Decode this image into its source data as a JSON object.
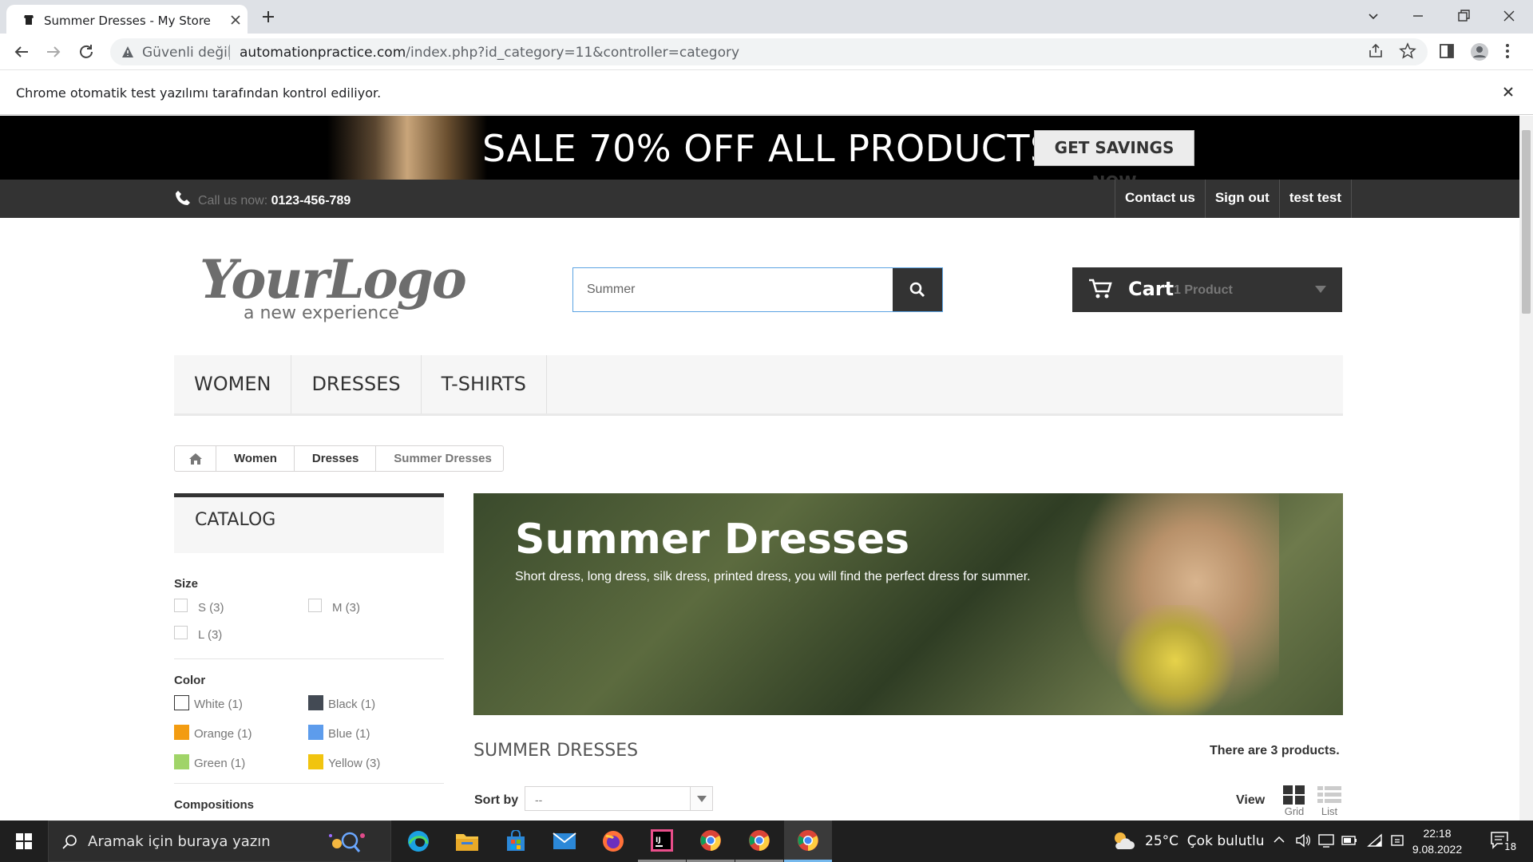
{
  "browser": {
    "tab_title": "Summer Dresses - My Store",
    "security_label": "Güvenli değil",
    "url_domain": "automationpractice.com",
    "url_path": "/index.php?id_category=11&controller=category",
    "infobar_text": "Chrome otomatik test yazılımı tarafından kontrol ediliyor."
  },
  "banner": {
    "text": "SALE 70% OFF ALL PRODUCTS",
    "button": "GET SAVINGS NOW"
  },
  "nav": {
    "call_label": "Call us now:",
    "phone": "0123-456-789",
    "links": [
      "Contact us",
      "Sign out",
      "test test"
    ]
  },
  "search": {
    "value": "Summer"
  },
  "cart": {
    "label": "Cart",
    "quantity": "1 Product"
  },
  "menu": [
    "WOMEN",
    "DRESSES",
    "T-SHIRTS"
  ],
  "breadcrumb": [
    "Women",
    "Dresses",
    "Summer Dresses"
  ],
  "catalog": {
    "title": "CATALOG",
    "size_title": "Size",
    "sizes": [
      "S (3)",
      "M (3)",
      "L (3)"
    ],
    "color_title": "Color",
    "colors": [
      {
        "label": "White (1)",
        "hex": "#ffffff"
      },
      {
        "label": "Black (1)",
        "hex": "#434a54"
      },
      {
        "label": "Orange (1)",
        "hex": "#f39c11"
      },
      {
        "label": "Blue (1)",
        "hex": "#5d9cec"
      },
      {
        "label": "Green (1)",
        "hex": "#a0d468"
      },
      {
        "label": "Yellow (3)",
        "hex": "#f1c40f"
      }
    ],
    "compositions_title": "Compositions"
  },
  "category": {
    "banner_title": "Summer Dresses",
    "banner_desc": "Short dress, long dress, silk dress, printed dress, you will find the perfect dress for summer.",
    "heading": "SUMMER DRESSES",
    "count": "There are 3 products.",
    "sort_label": "Sort by",
    "sort_value": "--",
    "view_label": "View",
    "view_grid": "Grid",
    "view_list": "List"
  },
  "taskbar": {
    "search_placeholder": "Aramak için buraya yazın",
    "weather": "25°C  Çok bulutlu",
    "time": "22:18",
    "date": "9.08.2022",
    "notifications": "18"
  }
}
